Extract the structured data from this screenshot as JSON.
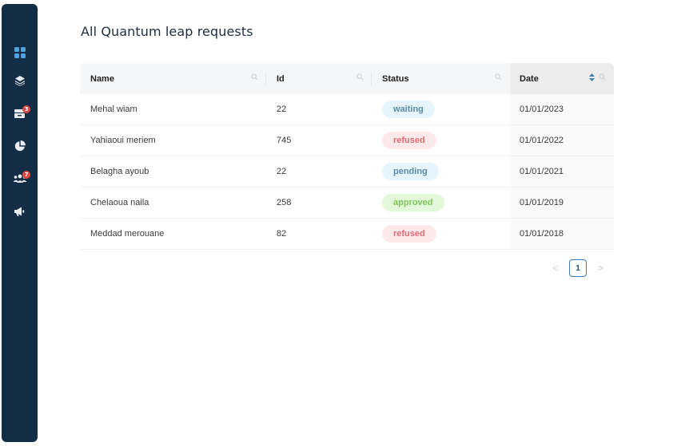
{
  "page": {
    "title": "All Quantum leap requests"
  },
  "sidebar": {
    "items": [
      {
        "name": "dashboard",
        "icon": "grid-icon",
        "badge": ""
      },
      {
        "name": "layers",
        "icon": "layers-icon",
        "badge": ""
      },
      {
        "name": "requests",
        "icon": "inbox-icon",
        "badge": "3"
      },
      {
        "name": "statistics",
        "icon": "pie-chart-icon",
        "badge": ""
      },
      {
        "name": "users",
        "icon": "users-icon",
        "badge": "7"
      },
      {
        "name": "announcements",
        "icon": "megaphone-icon",
        "badge": ""
      }
    ]
  },
  "table": {
    "columns": [
      {
        "label": "Name"
      },
      {
        "label": "Id"
      },
      {
        "label": "Status"
      },
      {
        "label": "Date"
      }
    ],
    "rows": [
      {
        "name": "Mehal wiam",
        "id": "22",
        "status": "waiting",
        "date": "01/01/2023"
      },
      {
        "name": "Yahiaoui meriem",
        "id": "745",
        "status": "refused",
        "date": "01/01/2022"
      },
      {
        "name": "Belagha ayoub",
        "id": "22",
        "status": "pending",
        "date": "01/01/2021"
      },
      {
        "name": "Chelaoua naila",
        "id": "258",
        "status": "approved",
        "date": "01/01/2019"
      },
      {
        "name": "Meddad merouane",
        "id": "82",
        "status": "refused",
        "date": "01/01/2018"
      }
    ]
  },
  "pagination": {
    "prev": "<",
    "current": "1",
    "next": ">"
  },
  "colors": {
    "sidebar": "#142d47",
    "badge": "#e0473f",
    "waiting": "#5a8aa6",
    "refused": "#e46b75",
    "approved": "#7fc45e",
    "pagination_accent": "#3d7fb5"
  }
}
